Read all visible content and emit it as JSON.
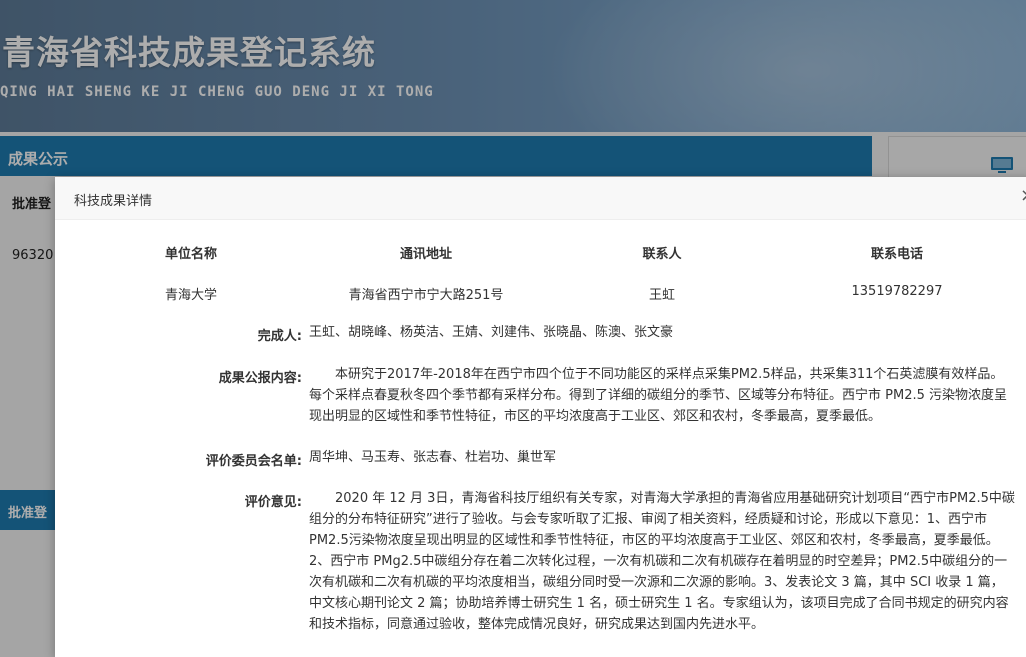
{
  "banner": {
    "title": "青海省科技成果登记系统",
    "subtitle": "QING HAI SHENG KE JI CHENG GUO DENG JI XI TONG"
  },
  "background": {
    "section_title": "成果公示",
    "approve_label": "批准登",
    "number_fragment": "96320",
    "lower_tab": "批准登"
  },
  "modal": {
    "title": "科技成果详情",
    "close": "×",
    "table": {
      "headers": [
        "单位名称",
        "通讯地址",
        "联系人",
        "联系电话"
      ],
      "row": [
        "青海大学",
        "青海省西宁市宁大路251号",
        "王虹",
        "13519782297"
      ]
    },
    "completers_label": "完成人:",
    "completers": "王虹、胡晓峰、杨英洁、王婧、刘建伟、张晓晶、陈澳、张文豪",
    "summary_label": "成果公报内容:",
    "summary": "本研究于2017年-2018年在西宁市四个位于不同功能区的采样点采集PM2.5样品，共采集311个石英滤膜有效样品。每个采样点春夏秋冬四个季节都有采样分布。得到了详细的碳组分的季节、区域等分布特征。西宁市 PM2.5 污染物浓度呈现出明显的区域性和季节性特征，市区的平均浓度高于工业区、郊区和农村，冬季最高，夏季最低。",
    "committee_label": "评价委员会名单:",
    "committee": "周华坤、马玉寿、张志春、杜岩功、巢世军",
    "opinion_label": "评价意见:",
    "opinion": "2020 年 12 月 3日，青海省科技厅组织有关专家，对青海大学承担的青海省应用基础研究计划项目“西宁市PM2.5中碳组分的分布特征研究”进行了验收。与会专家听取了汇报、审阅了相关资料，经质疑和讨论，形成以下意见：1、西宁市 PM2.5污染物浓度呈现出明显的区域性和季节性特征，市区的平均浓度高于工业区、郊区和农村，冬季最高，夏季最低。2、西宁市 PMg2.5中碳组分存在着二次转化过程，一次有机碳和二次有机碳存在着明显的时空差异；PM2.5中碳组分的一次有机碳和二次有机碳的平均浓度相当，碳组分同时受一次源和二次源的影响。3、发表论文 3 篇，其中 SCI 收录 1 篇，中文核心期刊论文 2 篇；协助培养博士研究生 1 名，硕士研究生 1 名。专家组认为，该项目完成了合同书规定的研究内容和技术指标，同意通过验收，整体完成情况良好，研究成果达到国内先进水平。"
  }
}
